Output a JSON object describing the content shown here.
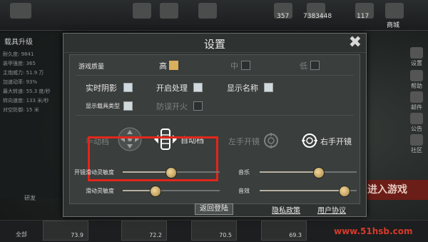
{
  "dialog": {
    "title": "设置",
    "close_symbol": "✖"
  },
  "settings": {
    "quality_label": "游戏质量",
    "quality_high": "高",
    "quality_mid": "中",
    "quality_low": "低",
    "realtime_shadow": "实时阴影",
    "post_processing": "开启处理",
    "show_name": "显示名称",
    "show_vehicle_type": "显示载具类型",
    "misfire_prevent": "防误开火",
    "manual_gear": "手动档",
    "auto_gear": "自动档",
    "left_scope": "左手开镜",
    "right_scope": "右手开镜",
    "scope_sensitivity_label": "开镜滑动灵敏度",
    "scope_sensitivity": 0.49,
    "slide_sensitivity_label": "滑动灵敏度",
    "slide_sensitivity": 0.33,
    "music_label": "音乐",
    "music": 0.6,
    "sfx_label": "音效",
    "sfx": 0.87
  },
  "footer": {
    "back_login": "返回登陆",
    "privacy": "隐私政策",
    "user_agreement": "用户协议"
  },
  "background": {
    "top_values": [
      "357",
      "7383448",
      "117"
    ],
    "store_label": "商城",
    "left_header": "载具升级",
    "left_rows": [
      "耐久度: 9841",
      "装甲强度: 365",
      "主炮威力: 51.9 万",
      "加速动率: 93%",
      "最大转速: 55.3 度/秒",
      "转向速度: 133 米/秒",
      "对空防御: 15 米"
    ],
    "right_items": [
      "设置",
      "帮助",
      "邮件",
      "公告",
      "社区"
    ],
    "enter_game": "进入游戏",
    "bottom_all": "全部",
    "tank_values": [
      "73.9",
      "72.2",
      "70.5",
      "69.3"
    ],
    "watermark": "www.51hsb.com",
    "left_block_label": "研发"
  },
  "colors": {
    "highlight": "#e3261b",
    "selected_quality": "#d9b05b",
    "dialog_bg": "#2e3230"
  }
}
